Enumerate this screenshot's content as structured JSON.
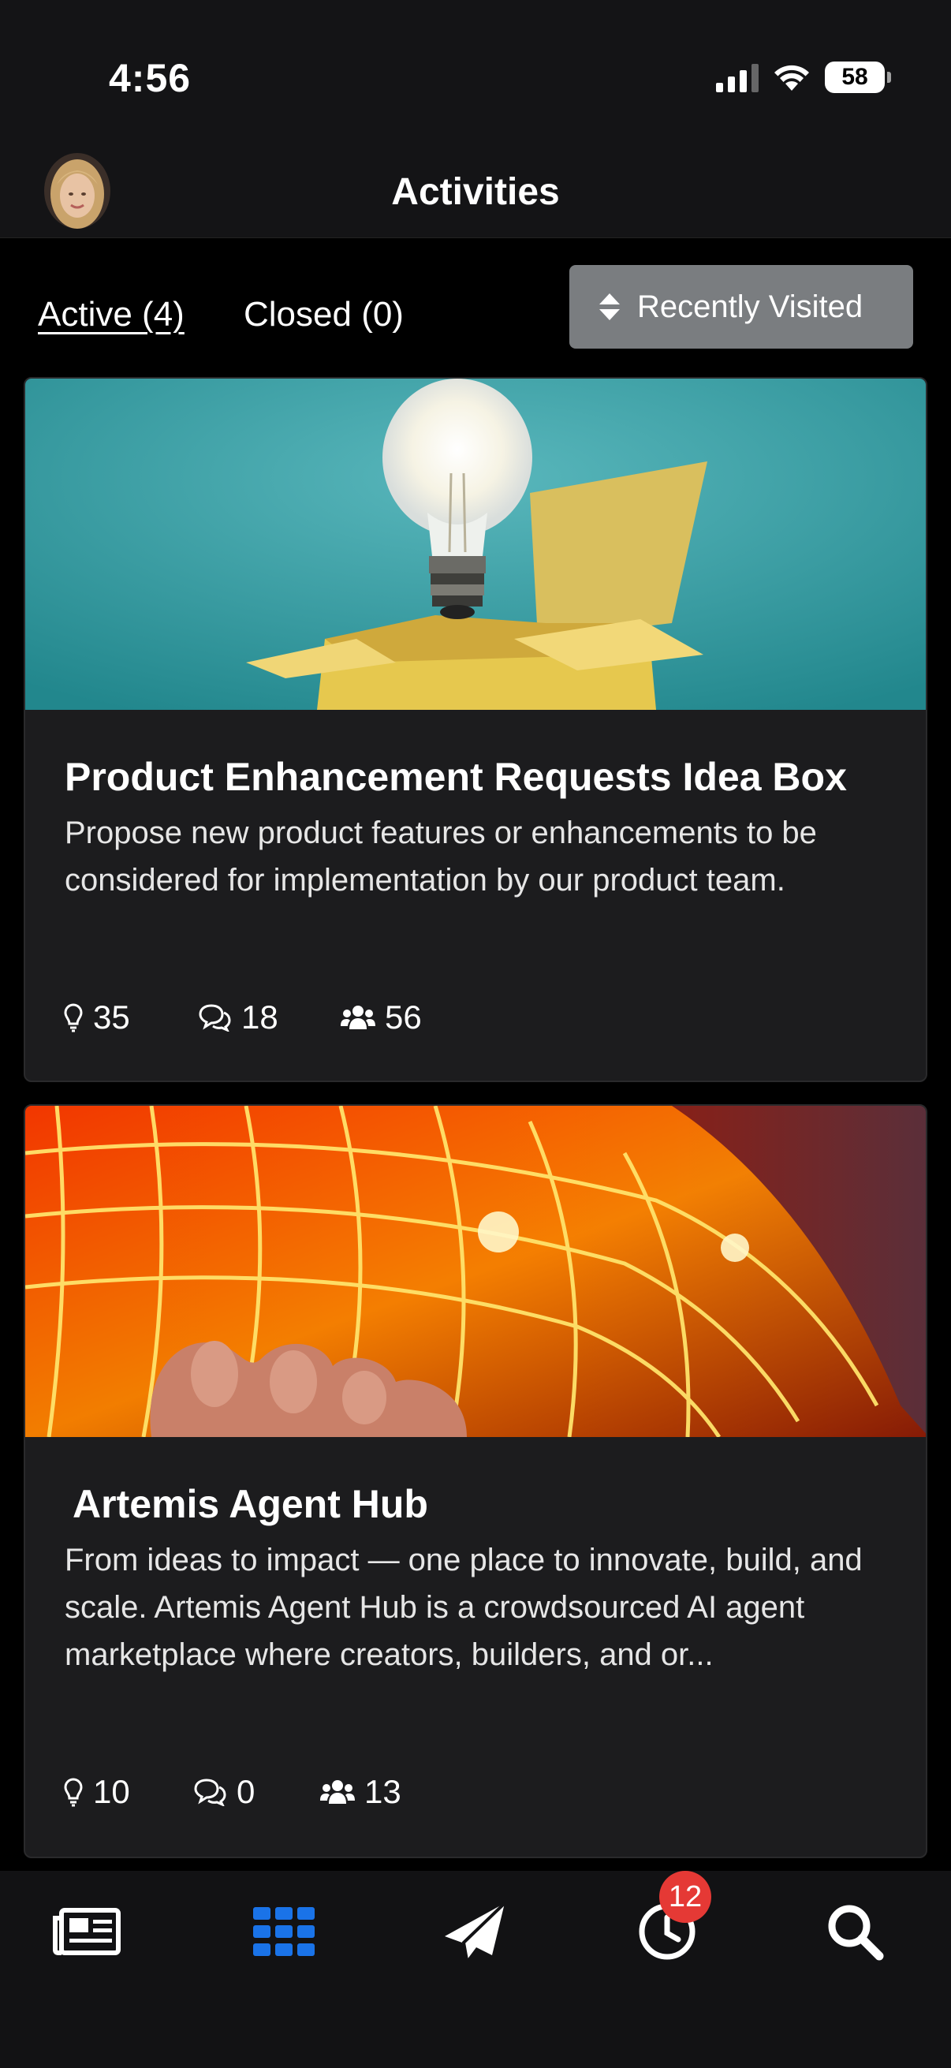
{
  "status_bar": {
    "time": "4:56",
    "battery": "58"
  },
  "header": {
    "title": "Activities"
  },
  "tabs": [
    {
      "label": "Active (4)",
      "active": true
    },
    {
      "label": "Closed (0)",
      "active": false
    }
  ],
  "sort": {
    "label": "Recently Visited"
  },
  "cards": [
    {
      "title": "Product Enhancement Requests Idea Box",
      "description": "Propose new product features or enhancements to be considered for implementation by our product team.",
      "ideas": "35",
      "comments": "18",
      "members": "56"
    },
    {
      "title": "Artemis Agent Hub",
      "description": "From ideas to impact — one place to innovate, build, and scale. Artemis Agent Hub is a crowdsourced AI agent marketplace where creators, builders, and or...",
      "ideas": "10",
      "comments": "0",
      "members": "13"
    }
  ],
  "nav": {
    "items": [
      "news-icon",
      "grid-icon",
      "paper-plane-icon",
      "activity-clock-icon",
      "search-icon"
    ],
    "active": "grid-icon",
    "badge": "12",
    "active_color": "#1a73e8"
  }
}
